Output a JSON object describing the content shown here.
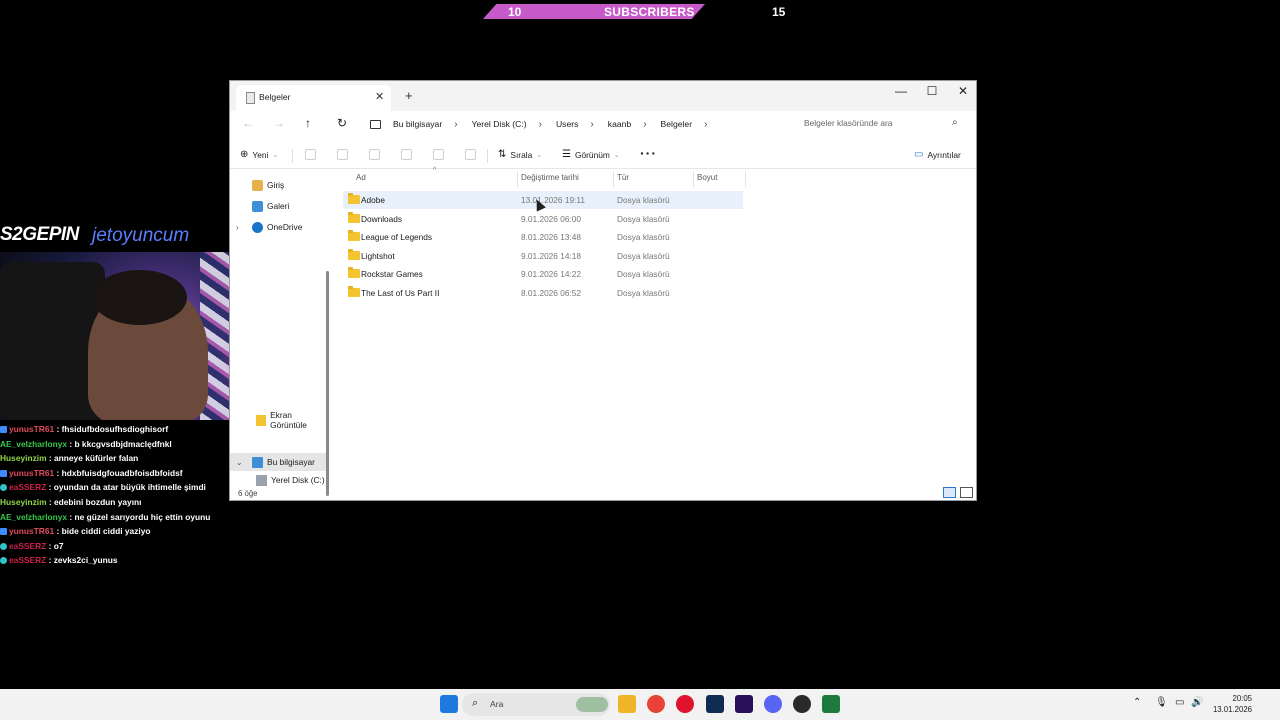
{
  "stream": {
    "subscribers": {
      "count": "10",
      "label": "SUBSCRIBERS",
      "goal": "15"
    },
    "brand": {
      "primary": "S2GEPIN",
      "partner": "jetoyuncum"
    },
    "chat": [
      {
        "user": "yunusTR61",
        "color": "#e04b5c",
        "badge": "square",
        "text": "fhsidufbdosufhsdioghisorf"
      },
      {
        "user": "AE_velzharlonyx",
        "color": "#37c84a",
        "badge": "",
        "text": "b kkcgvsdbjdmaclędfnkl"
      },
      {
        "user": "Huseyinzim",
        "color": "#8fd64a",
        "badge": "",
        "text": "anneye küfürler falan"
      },
      {
        "user": "yunusTR61",
        "color": "#e04b5c",
        "badge": "square",
        "text": "hdxbfuisdgfouadbfoisdbfoidsf"
      },
      {
        "user": "eaSSERZ",
        "color": "#c8224a",
        "badge": "round",
        "text": "oyundan da atar büyük ihtimelle şimdi"
      },
      {
        "user": "Huseyinzim",
        "color": "#8fd64a",
        "badge": "",
        "text": "edebini bozdun yayını"
      },
      {
        "user": "AE_velzharlonyx",
        "color": "#37c84a",
        "badge": "",
        "text": "ne güzel sarıyordu hiç ettin oyunu"
      },
      {
        "user": "yunusTR61",
        "color": "#e04b5c",
        "badge": "square",
        "text": "bide ciddi ciddi yaziyo"
      },
      {
        "user": "eaSSERZ",
        "color": "#c8224a",
        "badge": "round",
        "text": "o7"
      },
      {
        "user": "eaSSERZ",
        "color": "#c8224a",
        "badge": "round",
        "text": "zevks2ci_yunus"
      }
    ]
  },
  "explorer": {
    "tab_title": "Belgeler",
    "breadcrumb": [
      "Bu bilgisayar",
      "Yerel Disk (C:)",
      "Users",
      "kaanb",
      "Belgeler"
    ],
    "search_placeholder": "Belgeler klasöründe ara",
    "toolbar": {
      "new": "Yeni",
      "sort": "Sırala",
      "view": "Görünüm",
      "details": "Ayrıntılar"
    },
    "nav": {
      "home": "Giriş",
      "gallery": "Galeri",
      "onedrive": "OneDrive",
      "screenshots": "Ekran Görüntüle",
      "this_pc": "Bu bilgisayar",
      "local_disk": "Yerel Disk (C:)"
    },
    "columns": {
      "name": "Ad",
      "modified": "Değiştirme tarihi",
      "type": "Tür",
      "size": "Boyut"
    },
    "files": [
      {
        "name": "Adobe",
        "modified": "13.01.2026 19:11",
        "type": "Dosya klasörü",
        "selected": true
      },
      {
        "name": "Downloads",
        "modified": "9.01.2026 06:00",
        "type": "Dosya klasörü",
        "selected": false
      },
      {
        "name": "League of Legends",
        "modified": "8.01.2026 13:48",
        "type": "Dosya klasörü",
        "selected": false
      },
      {
        "name": "Lightshot",
        "modified": "9.01.2026 14:18",
        "type": "Dosya klasörü",
        "selected": false
      },
      {
        "name": "Rockstar Games",
        "modified": "9.01.2026 14:22",
        "type": "Dosya klasörü",
        "selected": false
      },
      {
        "name": "The Last of Us Part II",
        "modified": "8.01.2026 06:52",
        "type": "Dosya klasörü",
        "selected": false
      }
    ],
    "status_count": "6 öğe"
  },
  "taskbar": {
    "search_label": "Ara",
    "time": "20:05",
    "date": "13.01.2026",
    "apps": [
      {
        "name": "file-explorer-icon",
        "color": "#f0b429"
      },
      {
        "name": "chrome-icon",
        "color": "#e94235"
      },
      {
        "name": "opera-icon",
        "color": "#e0122c"
      },
      {
        "name": "photoshop-icon",
        "color": "#0f2c55"
      },
      {
        "name": "premiere-icon",
        "color": "#2a0f5a"
      },
      {
        "name": "discord-icon",
        "color": "#5865f2"
      },
      {
        "name": "obs-icon",
        "color": "#2a2a2a"
      },
      {
        "name": "terminal-icon",
        "color": "#1e7a3c"
      }
    ]
  }
}
